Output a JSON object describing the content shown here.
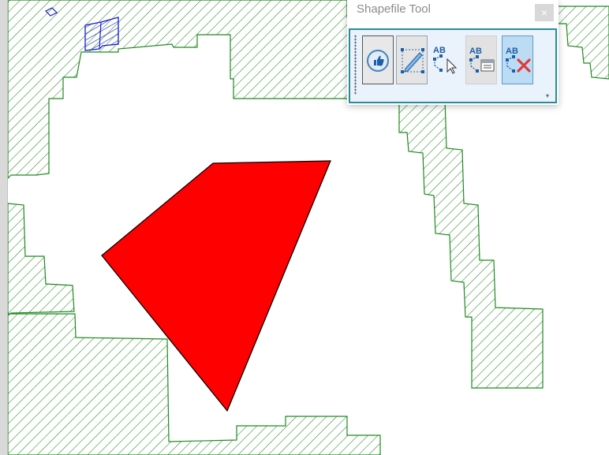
{
  "window": {
    "title": "Shapefile Tool",
    "close_glyph": "×"
  },
  "toolbar": {
    "buttons": [
      {
        "name": "approve",
        "icon": "thumbs-up-icon"
      },
      {
        "name": "draw",
        "icon": "draw-polygon-icon"
      },
      {
        "name": "select",
        "icon": "select-vertex-icon",
        "label": "AB"
      },
      {
        "name": "attributes",
        "icon": "edit-attributes-icon",
        "label": "AB"
      },
      {
        "name": "delete",
        "icon": "delete-vertex-icon",
        "label": "AB"
      }
    ],
    "overflow_glyph": "▾"
  },
  "colors": {
    "hatch_stroke": "#1f8a1f",
    "selection_fill": "#ff0000",
    "small_feature": "#1a1ad6",
    "toolbar_border": "#2a8c98",
    "delete_x": "#e23a3a",
    "icon_blue": "#1c5fa8"
  }
}
